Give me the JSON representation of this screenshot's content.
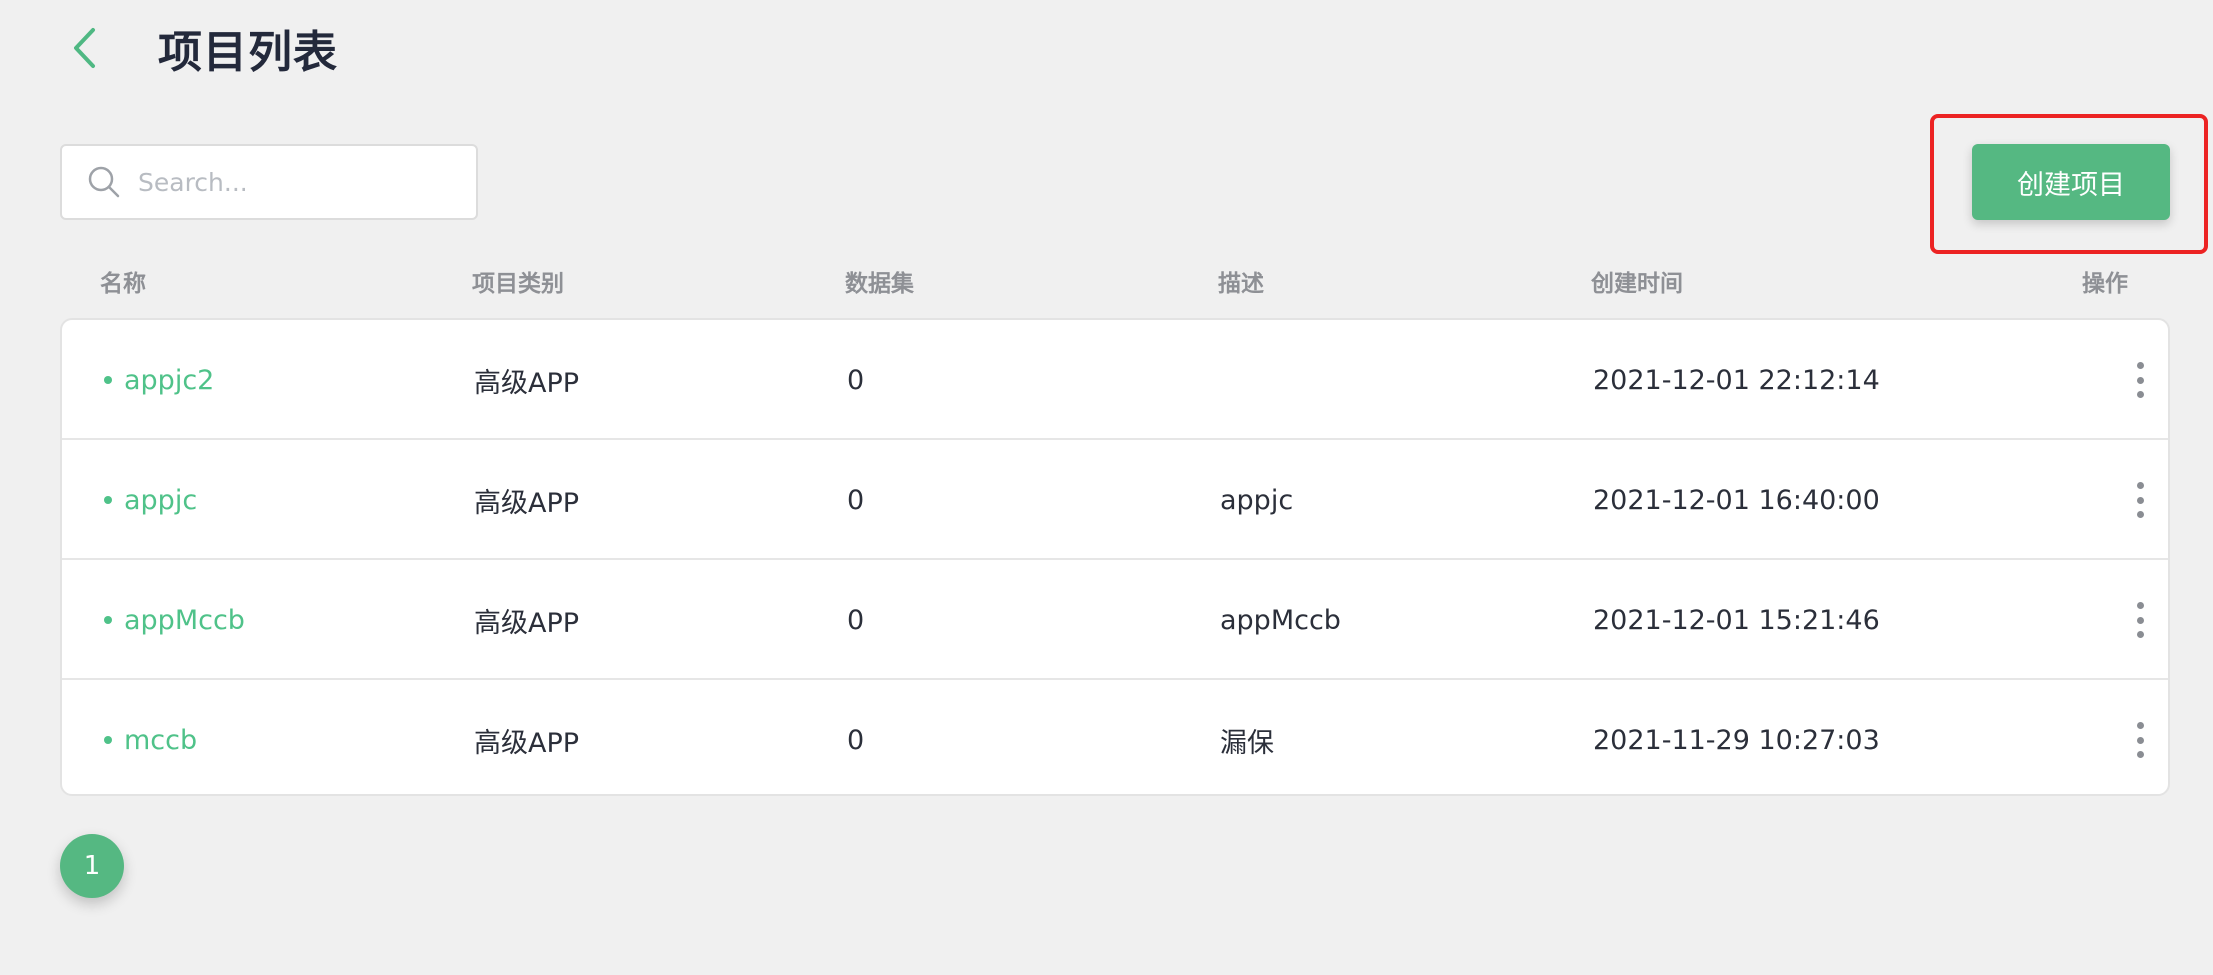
{
  "header": {
    "title": "项目列表",
    "back_icon": "chevron-left-icon"
  },
  "search": {
    "placeholder": "Search...",
    "value": ""
  },
  "toolbar": {
    "create_label": "创建项目"
  },
  "columns": [
    "名称",
    "项目类别",
    "数据集",
    "描述",
    "创建时间",
    "操作"
  ],
  "rows": [
    {
      "name": "appjc2",
      "category": "高级APP",
      "datasets": "0",
      "description": "",
      "created": "2021-12-01 22:12:14"
    },
    {
      "name": "appjc",
      "category": "高级APP",
      "datasets": "0",
      "description": "appjc",
      "created": "2021-12-01 16:40:00"
    },
    {
      "name": "appMccb",
      "category": "高级APP",
      "datasets": "0",
      "description": "appMccb",
      "created": "2021-12-01 15:21:46"
    },
    {
      "name": "mccb",
      "category": "高级APP",
      "datasets": "0",
      "description": "漏保",
      "created": "2021-11-29 10:27:03"
    }
  ],
  "pagination": {
    "current": "1"
  },
  "colors": {
    "accent": "#55b882",
    "highlight": "#ec2323",
    "background": "#f0f0f0"
  }
}
